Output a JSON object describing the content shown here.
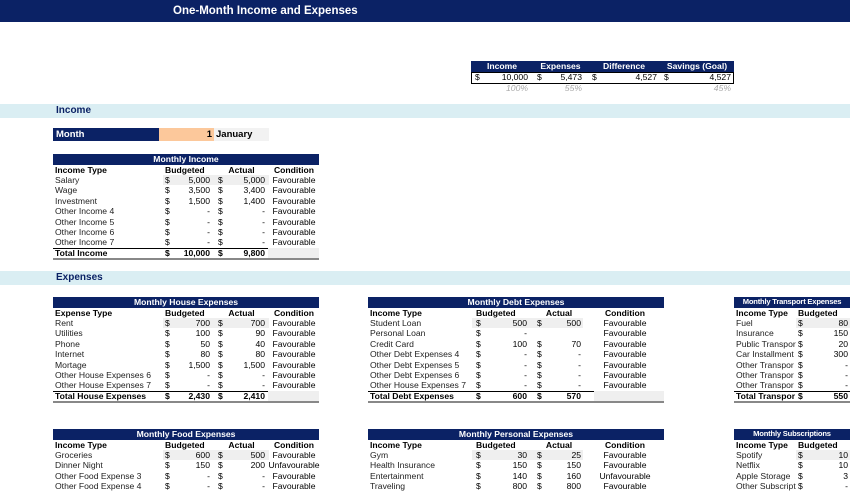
{
  "title": "One-Month Income and Expenses",
  "summary": {
    "headers": [
      "Income",
      "Expenses",
      "Difference",
      "Savings (Goal)"
    ],
    "currency": "$",
    "values": [
      "10,000",
      "5,473",
      "4,527",
      "4,527"
    ],
    "percents": [
      "100%",
      "55%",
      "",
      "45%"
    ]
  },
  "sections": {
    "income": "Income",
    "expenses": "Expenses"
  },
  "month": {
    "label": "Month",
    "number": "1",
    "name": "January"
  },
  "colors": {
    "navy": "#0b2265",
    "band": "#daeef3",
    "month_input": "#fcc89b"
  },
  "tables": {
    "income": {
      "title": "Monthly Income",
      "headers": [
        "Income Type",
        "Budgeted",
        "Actual",
        "Condition"
      ],
      "rows": [
        [
          "Salary",
          "5,000",
          "5,000",
          "Favourable"
        ],
        [
          "Wage",
          "3,500",
          "3,400",
          "Favourable"
        ],
        [
          "Investment",
          "1,500",
          "1,400",
          "Favourable"
        ],
        [
          "Other Income 4",
          "-",
          "-",
          "Favourable"
        ],
        [
          "Other Income 5",
          "-",
          "-",
          "Favourable"
        ],
        [
          "Other Income 6",
          "-",
          "-",
          "Favourable"
        ],
        [
          "Other Income 7",
          "-",
          "-",
          "Favourable"
        ]
      ],
      "total": [
        "Total Income",
        "10,000",
        "9,800"
      ]
    },
    "house": {
      "title": "Monthly House Expenses",
      "headers": [
        "Expense Type",
        "Budgeted",
        "Actual",
        "Condition"
      ],
      "rows": [
        [
          "Rent",
          "700",
          "700",
          "Favourable"
        ],
        [
          "Utilities",
          "100",
          "90",
          "Favourable"
        ],
        [
          "Phone",
          "50",
          "40",
          "Favourable"
        ],
        [
          "Internet",
          "80",
          "80",
          "Favourable"
        ],
        [
          "Mortage",
          "1,500",
          "1,500",
          "Favourable"
        ],
        [
          "Other House Expenses 6",
          "-",
          "-",
          "Favourable"
        ],
        [
          "Other House Expenses 7",
          "-",
          "-",
          "Favourable"
        ]
      ],
      "total": [
        "Total House Expenses",
        "2,430",
        "2,410"
      ]
    },
    "debt": {
      "title": "Monthly Debt Expenses",
      "headers": [
        "Income Type",
        "Budgeted",
        "Actual",
        "Condition"
      ],
      "rows": [
        [
          "Student Loan",
          "500",
          "500",
          "Favourable"
        ],
        [
          "Personal Loan",
          "-",
          "",
          "Favourable"
        ],
        [
          "Credit Card",
          "100",
          "70",
          "Favourable"
        ],
        [
          "Other Debt Expenses 4",
          "-",
          "-",
          "Favourable"
        ],
        [
          "Other Debt Expenses 5",
          "-",
          "-",
          "Favourable"
        ],
        [
          "Other Debt Expenses 6",
          "-",
          "-",
          "Favourable"
        ],
        [
          "Other House Expenses 7",
          "-",
          "-",
          "Favourable"
        ]
      ],
      "total": [
        "Total Debt Expenses",
        "600",
        "570"
      ]
    },
    "transport": {
      "title": "Monthly Transport Expenses",
      "headers": [
        "Income Type",
        "Budgeted",
        "",
        ""
      ],
      "rows": [
        [
          "Fuel",
          "80",
          "",
          ""
        ],
        [
          "Insurance",
          "150",
          "",
          ""
        ],
        [
          "Public Transpor",
          "20",
          "",
          ""
        ],
        [
          "Car Installment",
          "300",
          "",
          ""
        ],
        [
          "Other Transpor",
          "-",
          "",
          ""
        ],
        [
          "Other Transpor",
          "-",
          "",
          ""
        ],
        [
          "Other Transpor",
          "-",
          "",
          ""
        ]
      ],
      "total": [
        "Total Transpor",
        "550",
        ""
      ]
    },
    "food": {
      "title": "Monthly Food Expenses",
      "headers": [
        "Income Type",
        "Budgeted",
        "Actual",
        "Condition"
      ],
      "rows": [
        [
          "Groceries",
          "600",
          "500",
          "Favourable"
        ],
        [
          "Dinner Night",
          "150",
          "200",
          "Unfavourable"
        ],
        [
          "Other Food Expense 3",
          "-",
          "-",
          "Favourable"
        ],
        [
          "Other Food Expense 4",
          "-",
          "-",
          "Favourable"
        ]
      ]
    },
    "personal": {
      "title": "Monthly Personal Expenses",
      "headers": [
        "Income Type",
        "Budgeted",
        "Actual",
        "Condition"
      ],
      "rows": [
        [
          "Gym",
          "30",
          "25",
          "Favourable"
        ],
        [
          "Health Insurance",
          "150",
          "150",
          "Favourable"
        ],
        [
          "Entertainment",
          "140",
          "160",
          "Unfavourable"
        ],
        [
          "Traveling",
          "800",
          "800",
          "Favourable"
        ]
      ]
    },
    "subscriptions": {
      "title": "Monthly Subscriptions",
      "headers": [
        "Income Type",
        "Budgeted",
        "",
        ""
      ],
      "rows": [
        [
          "Spotify",
          "10",
          "",
          ""
        ],
        [
          "Netflix",
          "10",
          "",
          ""
        ],
        [
          "Apple Storage",
          "3",
          "",
          ""
        ],
        [
          "Other Subscript",
          "-",
          "",
          ""
        ]
      ]
    }
  }
}
